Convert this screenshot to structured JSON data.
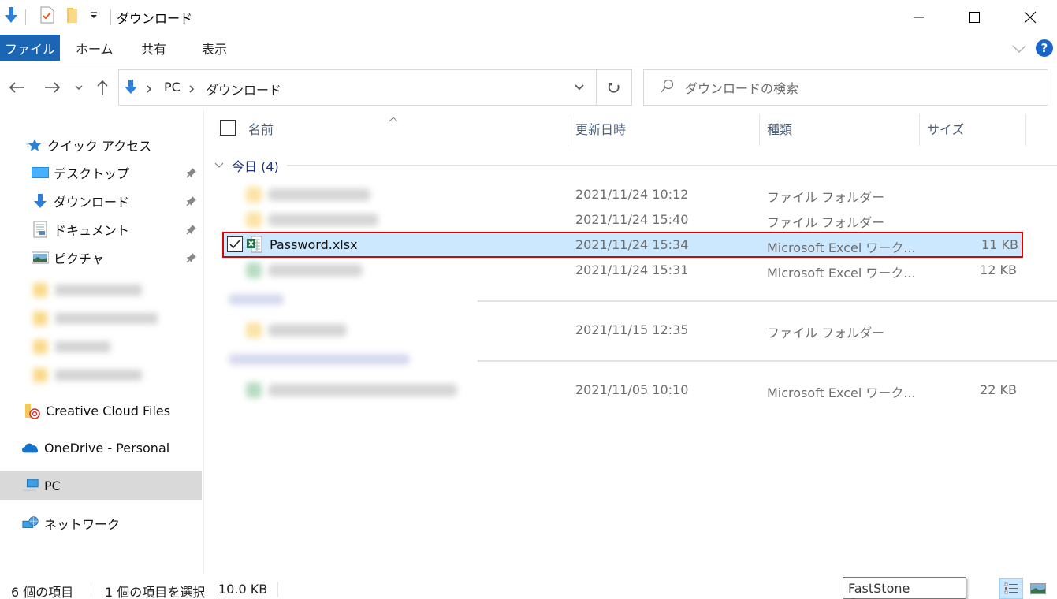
{
  "window": {
    "title": "ダウンロード",
    "controls": {
      "minimize": "minimize",
      "maximize": "maximize",
      "close": "close"
    }
  },
  "quick_access_toolbar": {
    "icons": [
      "down-arrow-icon",
      "properties-checkmark-icon",
      "new-folder-icon",
      "customize-dropdown-icon"
    ]
  },
  "ribbon": {
    "tabs": [
      {
        "label": "ファイル",
        "active": true
      },
      {
        "label": "ホーム"
      },
      {
        "label": "共有"
      },
      {
        "label": "表示"
      }
    ],
    "help": "?"
  },
  "nav": {
    "breadcrumb": [
      "PC",
      "ダウンロード"
    ],
    "search_placeholder": "ダウンロードの検索"
  },
  "sidebar": {
    "quick_access": {
      "label": "クイック アクセス",
      "items": [
        {
          "label": "デスクトップ",
          "icon": "desktop-icon",
          "pinned": true
        },
        {
          "label": "ダウンロード",
          "icon": "download-icon",
          "pinned": true
        },
        {
          "label": "ドキュメント",
          "icon": "document-icon",
          "pinned": true
        },
        {
          "label": "ピクチャ",
          "icon": "pictures-icon",
          "pinned": true
        }
      ]
    },
    "other": [
      {
        "label": "Creative Cloud Files",
        "icon": "creative-cloud-icon"
      },
      {
        "label": "OneDrive - Personal",
        "icon": "onedrive-icon"
      },
      {
        "label": "PC",
        "icon": "pc-icon",
        "selected": true
      },
      {
        "label": "ネットワーク",
        "icon": "network-icon"
      }
    ]
  },
  "columns": {
    "name": "名前",
    "modified": "更新日時",
    "type": "種類",
    "size": "サイズ"
  },
  "groups": [
    {
      "label": "今日 (4)",
      "rows": [
        {
          "name": "",
          "modified": "2021/11/24 10:12",
          "type": "ファイル フォルダー",
          "size": "",
          "icon": "folder"
        },
        {
          "name": "",
          "modified": "2021/11/24 15:40",
          "type": "ファイル フォルダー",
          "size": "",
          "icon": "folder"
        },
        {
          "name": "Password.xlsx",
          "modified": "2021/11/24 15:34",
          "type": "Microsoft Excel ワーク...",
          "size": "11 KB",
          "icon": "excel",
          "selected": true
        },
        {
          "name": "",
          "modified": "2021/11/24 15:31",
          "type": "Microsoft Excel ワーク...",
          "size": "12 KB",
          "icon": "excel"
        }
      ]
    },
    {
      "label": "",
      "rows": [
        {
          "name": "",
          "modified": "2021/11/15 12:35",
          "type": "ファイル フォルダー",
          "size": "",
          "icon": "folder"
        }
      ]
    },
    {
      "label": "",
      "rows": [
        {
          "name": "",
          "modified": "2021/11/05 10:10",
          "type": "Microsoft Excel ワーク...",
          "size": "22 KB",
          "icon": "excel"
        }
      ]
    }
  ],
  "status": {
    "item_count": "6 個の項目",
    "selection": "1 個の項目を選択",
    "selection_size": "10.0 KB"
  },
  "tooltip": "FastStone Capture",
  "colors": {
    "accent": "#1a66b5",
    "selection_bg": "#cce8ff",
    "highlight_border": "#e00000",
    "group_header": "#1e3287"
  }
}
